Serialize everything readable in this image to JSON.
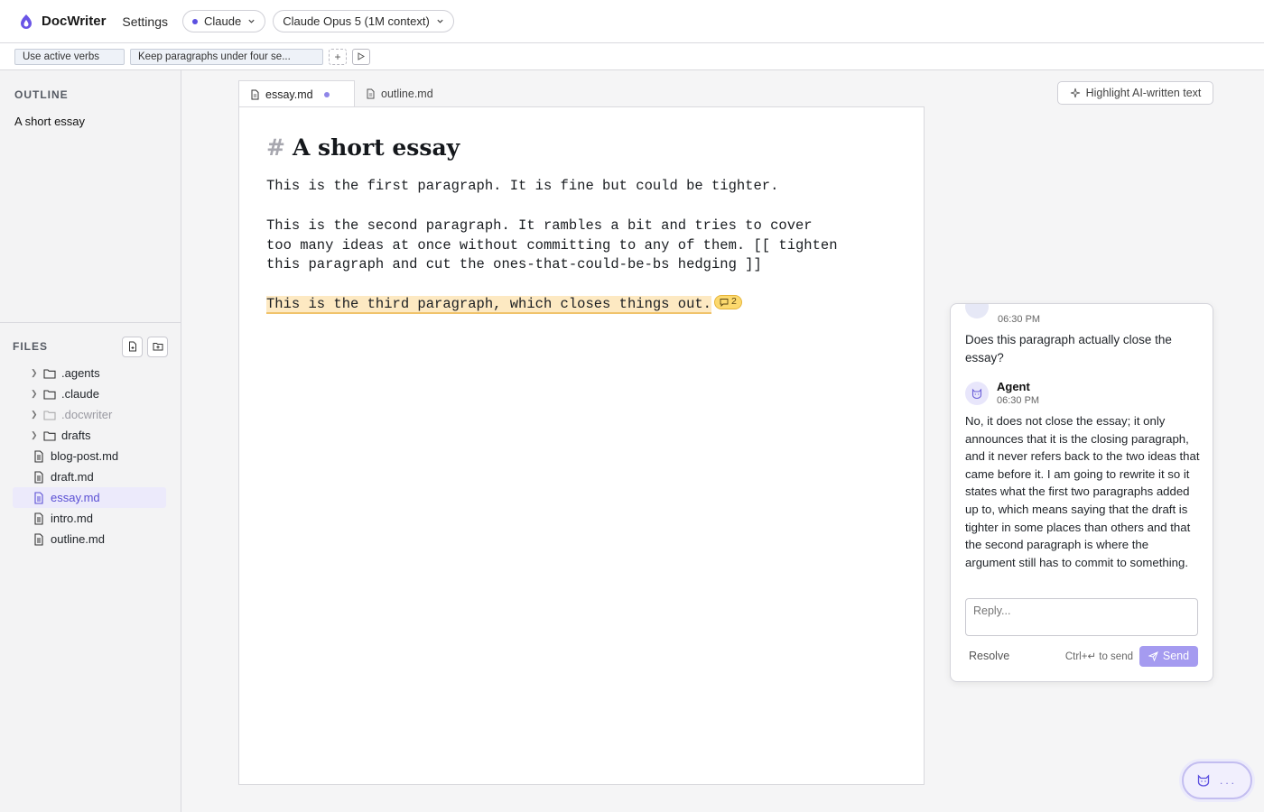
{
  "app": {
    "name": "DocWriter",
    "settings_label": "Settings"
  },
  "provider": {
    "label": "Claude"
  },
  "model": {
    "label": "Claude Opus 5 (1M context)"
  },
  "rules": {
    "items": [
      "Use active verbs",
      "Keep paragraphs under four se..."
    ],
    "add_label": "+"
  },
  "outline": {
    "title": "OUTLINE",
    "items": [
      "A short essay"
    ]
  },
  "files": {
    "title": "FILES",
    "tree": [
      {
        "label": ".agents",
        "type": "folder"
      },
      {
        "label": ".claude",
        "type": "folder"
      },
      {
        "label": ".docwriter",
        "type": "folder"
      },
      {
        "label": "drafts",
        "type": "folder"
      },
      {
        "label": "blog-post.md",
        "type": "file"
      },
      {
        "label": "draft.md",
        "type": "file"
      },
      {
        "label": "essay.md",
        "type": "file"
      },
      {
        "label": "intro.md",
        "type": "file"
      },
      {
        "label": "outline.md",
        "type": "file"
      }
    ]
  },
  "tabs": [
    {
      "label": "essay.md"
    },
    {
      "label": "outline.md"
    }
  ],
  "highlight_button": {
    "label": "Highlight AI-written text"
  },
  "document": {
    "hash": "#",
    "heading": "A short essay",
    "p1": "This is the first paragraph. It is fine but could be tighter.",
    "p2": "This is the second paragraph. It rambles a bit and tries to cover too many ideas at once without committing to any of them. [[ tighten this paragraph and cut the ones-that-could-be-bs hedging ]]",
    "p3": "This is the third paragraph, which closes things out.",
    "comment_count": "2"
  },
  "comment_thread": {
    "first_time": "06:30 PM",
    "question": "Does this paragraph actually close the essay?",
    "reply_author": "Agent",
    "reply_time": "06:30 PM",
    "reply_text": "No, it does not close the essay; it only announces that it is the closing paragraph, and it never refers back to the two ideas that came before it. I am going to rewrite it so it states what the first two paragraphs added up to, which means saying that the draft is tighter in some places than others and that the second paragraph is where the argument still has to commit to something.",
    "reply_placeholder": "Reply...",
    "resolve_label": "Resolve",
    "send_hint": "Ctrl+↵ to send",
    "send_label": "Send"
  },
  "agent_fab": {
    "dots": "..."
  },
  "colors": {
    "accent": "#5b4fe0",
    "highlight": "#fde9c2",
    "badge": "#fcd96e",
    "send": "#a59bf0"
  }
}
